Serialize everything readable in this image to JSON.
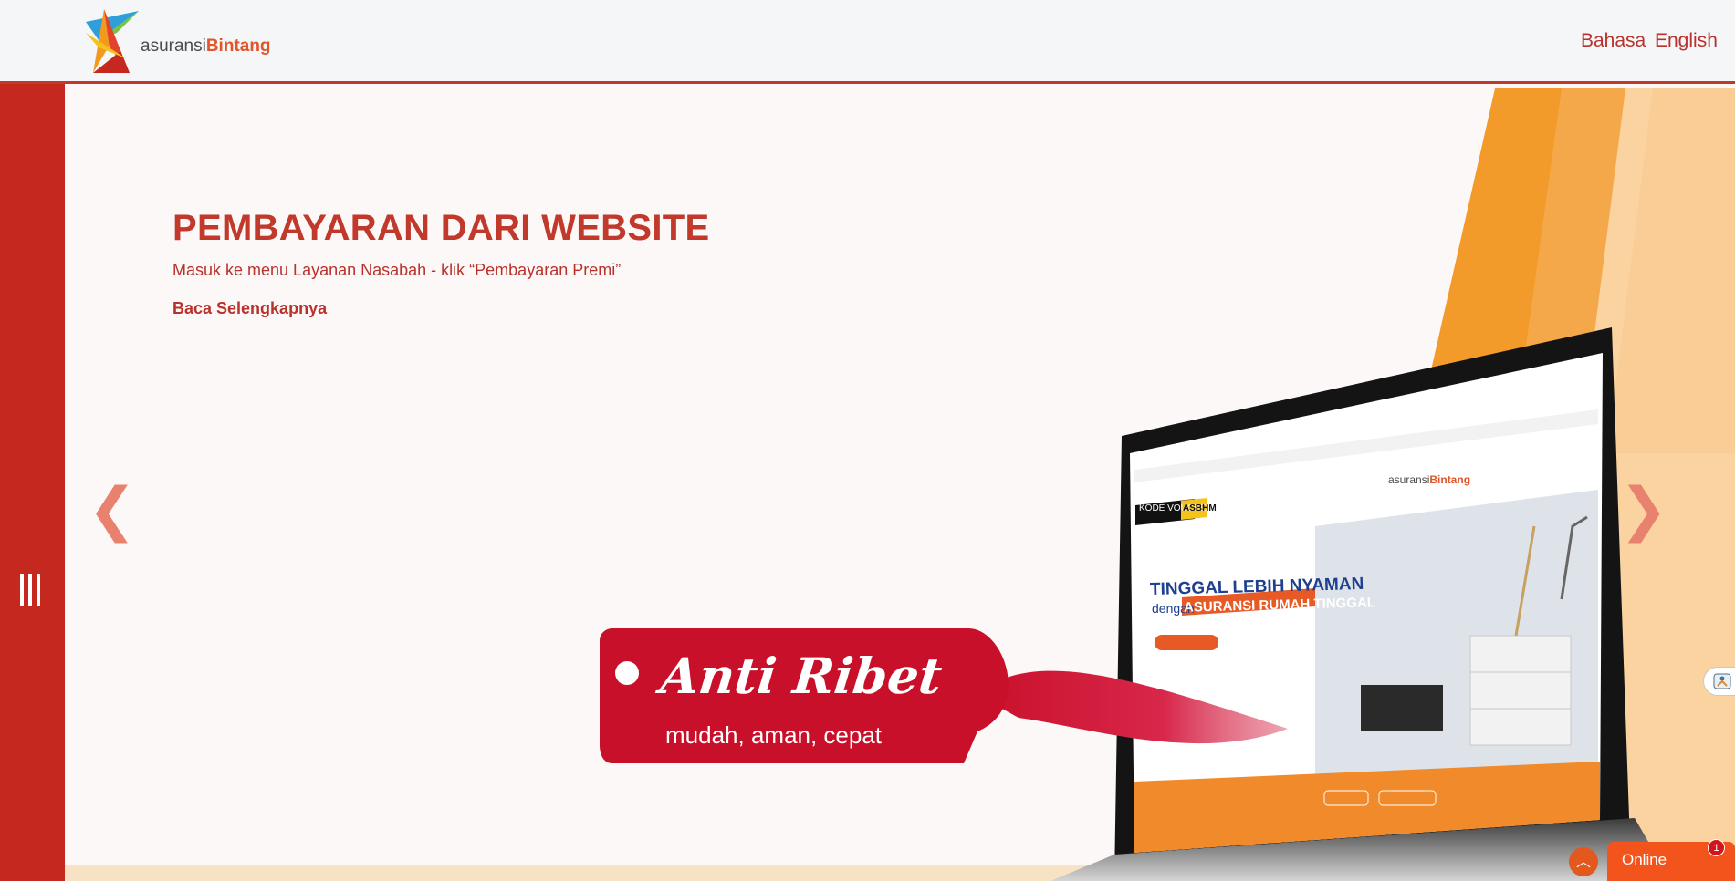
{
  "header": {
    "logo_text_prefix": "asuransi",
    "logo_text_brand": "Bintang",
    "lang_bahasa": "Bahasa",
    "lang_english": "English"
  },
  "slide": {
    "title": "PEMBAYARAN DARI WEBSITE",
    "subtitle": "Masuk ke menu Layanan Nasabah - klik “Pembayaran Premi”",
    "read_more": "Baca Selengkapnya",
    "prev_arrow": "❮",
    "next_arrow": "❯",
    "tag_script": "Anti Ribet",
    "tag_tagline": "mudah, aman, cepat",
    "screen": {
      "voucher_label": "KODE VOUCHER",
      "voucher_code": "ASBHM",
      "headline": "TINGGAL LEBIH NYAMAN",
      "dengan": "dengan",
      "headline_product": "ASURANSI RUMAH TINGGAL",
      "logo_prefix": "asuransi",
      "logo_brand": "Bintang"
    }
  },
  "widgets": {
    "scroll_top_icon": "chevron-up-icon",
    "chat_label": "Online",
    "chat_badge": "1"
  },
  "colors": {
    "brand_red": "#c0392b",
    "sidebar_red": "#c4281e",
    "accent_orange": "#f39b2a",
    "chat_orange": "#f2541b"
  }
}
